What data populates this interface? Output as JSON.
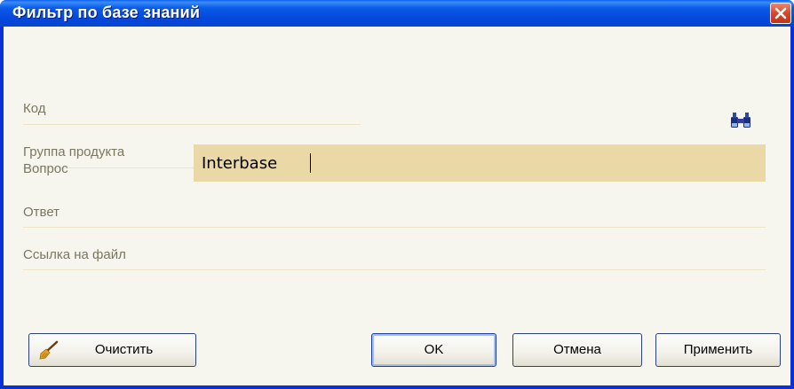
{
  "window": {
    "title": "Фильтр по базе знаний",
    "close_icon": "close-icon"
  },
  "form": {
    "fields": [
      {
        "label": "Код"
      },
      {
        "label": "Группа продукта"
      },
      {
        "label": "Вопрос",
        "value": "Interbase"
      },
      {
        "label": "Ответ"
      },
      {
        "label": "Ссылка на файл"
      }
    ],
    "product_group_search_icon": "binoculars-icon"
  },
  "buttons": {
    "clear_label": "Очистить",
    "clear_icon": "broom-icon",
    "ok_label": "OK",
    "cancel_label": "Отмена",
    "apply_label": "Применить"
  }
}
